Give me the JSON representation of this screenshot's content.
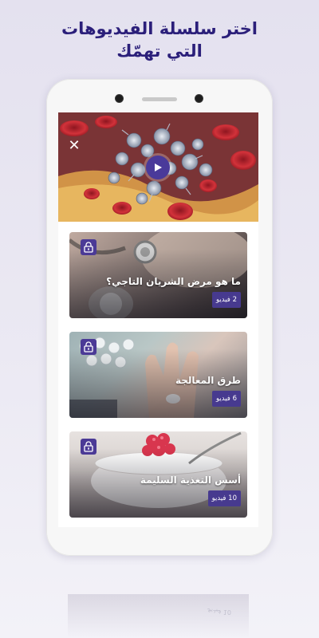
{
  "headline": {
    "line1": "اختر سلسلة الفيديوهات",
    "line2": "التي تهمّك"
  },
  "hero": {
    "close_icon": "close-icon",
    "play_icon": "play-icon"
  },
  "cards": [
    {
      "title": "ما هو مرض الشريان التاجي؟",
      "badge": "2 فيديو",
      "icon": "lock-icon"
    },
    {
      "title": "طرق المعالجة",
      "badge": "6 فيديو",
      "icon": "lock-icon"
    },
    {
      "title": "أسس التغذية السليمة",
      "badge": "10 فيديو",
      "icon": "lock-icon"
    }
  ],
  "reflection": {
    "badge": "10 فيديو"
  },
  "colors": {
    "accent": "#4b3a96",
    "headline": "#2b1f7a",
    "background": "#e9e7f2"
  }
}
